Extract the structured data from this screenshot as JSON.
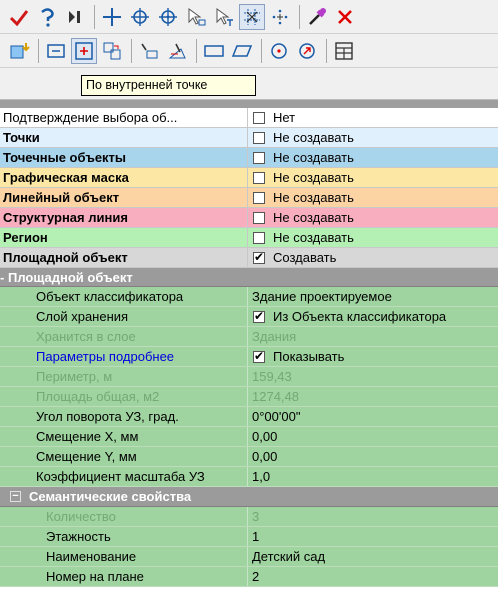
{
  "toolbar1": [
    {
      "name": "check-icon",
      "pressed": false
    },
    {
      "name": "undo-icon",
      "pressed": false
    },
    {
      "name": "next-point-icon",
      "pressed": false
    },
    {
      "name": "crosshair-icon",
      "pressed": false
    },
    {
      "name": "target-icon",
      "pressed": false
    },
    {
      "name": "target-alt-icon",
      "pressed": false
    },
    {
      "name": "select-cursor-icon",
      "pressed": false
    },
    {
      "name": "select-cursor-text-icon",
      "pressed": false
    },
    {
      "name": "snap-grid-icon",
      "pressed": true
    },
    {
      "name": "snap-dots-icon",
      "pressed": false
    },
    {
      "name": "eyedropper-icon",
      "pressed": false
    },
    {
      "name": "close-icon",
      "pressed": false
    }
  ],
  "toolbar2": [
    {
      "name": "create-object-icon",
      "pressed": false
    },
    {
      "name": "remove-rect-icon",
      "pressed": false
    },
    {
      "name": "inner-point-icon",
      "pressed": true
    },
    {
      "name": "merge-icon",
      "pressed": false
    },
    {
      "name": "draw-line-icon",
      "pressed": false
    },
    {
      "name": "draw-shape-icon",
      "pressed": false
    },
    {
      "name": "rectangle-icon",
      "pressed": false
    },
    {
      "name": "parallelogram-icon",
      "pressed": false
    },
    {
      "name": "circle-point-icon",
      "pressed": false
    },
    {
      "name": "circle-arrow-icon",
      "pressed": false
    },
    {
      "name": "table-icon",
      "pressed": false
    }
  ],
  "tooltip": "По внутренней точке",
  "rows": [
    {
      "label": "Подтверждение выбора об...",
      "value": "Нет",
      "checked": false,
      "bold": false,
      "color": "white"
    },
    {
      "label": "Точки",
      "value": "Не создавать",
      "checked": false,
      "bold": true,
      "color": "lblue"
    },
    {
      "label": "Точечные объекты",
      "value": "Не создавать",
      "checked": false,
      "bold": true,
      "color": "blue"
    },
    {
      "label": "Графическая маска",
      "value": "Не создавать",
      "checked": false,
      "bold": true,
      "color": "yellow"
    },
    {
      "label": "Линейный объект",
      "value": "Не создавать",
      "checked": false,
      "bold": true,
      "color": "peach"
    },
    {
      "label": "Структурная линия",
      "value": "Не создавать",
      "checked": false,
      "bold": true,
      "color": "pink"
    },
    {
      "label": "Регион",
      "value": "Не создавать",
      "checked": false,
      "bold": true,
      "color": "green"
    },
    {
      "label": "Площадной объект",
      "value": "Создавать",
      "checked": true,
      "bold": true,
      "color": "gray"
    }
  ],
  "section_title": "Площадной объект",
  "props": [
    {
      "label": "Объект классификатора",
      "value": "Здание проектируемое",
      "checkbox": false,
      "checked": false,
      "disabled": false,
      "link": false
    },
    {
      "label": "Слой хранения",
      "value": "Из Объекта классификатора",
      "checkbox": true,
      "checked": true,
      "disabled": false,
      "link": false
    },
    {
      "label": "Хранится в слое",
      "value": "Здания",
      "checkbox": false,
      "checked": false,
      "disabled": true,
      "link": false
    },
    {
      "label": "Параметры подробнее",
      "value": "Показывать",
      "checkbox": true,
      "checked": true,
      "disabled": false,
      "link": true
    },
    {
      "label": "Периметр, м",
      "value": "159,43",
      "checkbox": false,
      "checked": false,
      "disabled": true,
      "link": false
    },
    {
      "label": "Площадь общая, м2",
      "value": "1274,48",
      "checkbox": false,
      "checked": false,
      "disabled": true,
      "link": false
    },
    {
      "label": "Угол поворота УЗ, град.",
      "value": "0°00'00\"",
      "checkbox": false,
      "checked": false,
      "disabled": false,
      "link": false
    },
    {
      "label": "Смещение X, мм",
      "value": "0,00",
      "checkbox": false,
      "checked": false,
      "disabled": false,
      "link": false
    },
    {
      "label": "Смещение Y, мм",
      "value": "0,00",
      "checkbox": false,
      "checked": false,
      "disabled": false,
      "link": false
    },
    {
      "label": "Коэффициент масштаба УЗ",
      "value": "1,0",
      "checkbox": false,
      "checked": false,
      "disabled": false,
      "link": false
    }
  ],
  "semantic_title": "Семантические свойства",
  "semantic": [
    {
      "label": "Количество",
      "value": "3",
      "disabled": true
    },
    {
      "label": "Этажность",
      "value": "1",
      "disabled": false
    },
    {
      "label": "Наименование",
      "value": "Детский сад",
      "disabled": false
    },
    {
      "label": "Номер на плане",
      "value": "2",
      "disabled": false
    }
  ]
}
